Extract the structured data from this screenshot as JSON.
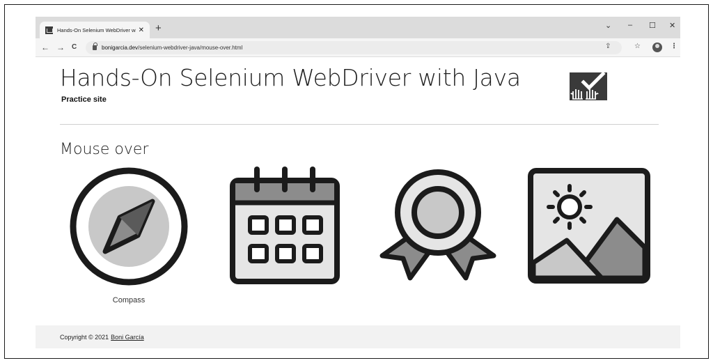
{
  "browser": {
    "tab_title": "Hands-On Selenium WebDriver with Java",
    "tab_close": "✕",
    "new_tab": "+",
    "url_host": "bonigarcia.dev",
    "url_path": "/selenium-webdriver-java/mouse-over.html",
    "window_controls": {
      "dropdown": "⌄",
      "minimize": "–",
      "maximize": "☐",
      "close": "✕"
    },
    "nav": {
      "back": "←",
      "forward": "→",
      "reload": "C"
    },
    "toolbar": {
      "share": "⇪",
      "bookmark": "☆",
      "menu": "⋮"
    }
  },
  "page": {
    "title": "Hands-On Selenium WebDriver with Java",
    "subtitle": "Practice site",
    "section_title": "Mouse over",
    "figures": [
      {
        "name": "compass-icon",
        "caption": "Compass"
      },
      {
        "name": "calendar-icon",
        "caption": ""
      },
      {
        "name": "award-icon",
        "caption": ""
      },
      {
        "name": "landscape-icon",
        "caption": ""
      }
    ],
    "footer": {
      "copyright": "Copyright © 2021",
      "author_link": "Boni García"
    }
  },
  "colors": {
    "dark": "#1b1b1b",
    "mid_gray": "#8c8c8c",
    "light_gray": "#c8c8c8",
    "footer_bg": "#f2f2f2"
  }
}
